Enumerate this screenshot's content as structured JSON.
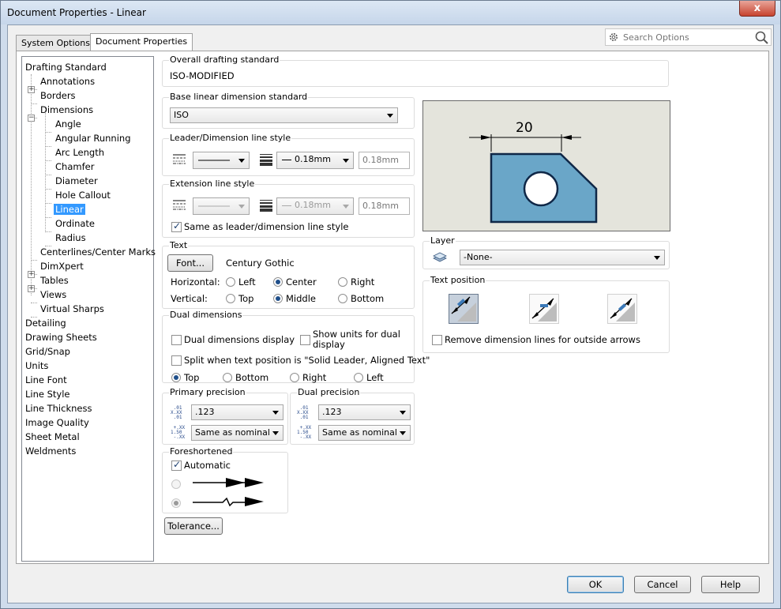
{
  "window": {
    "title": "Document Properties - Linear",
    "close_label": "x"
  },
  "tabs": [
    {
      "label": "System Options",
      "active": false
    },
    {
      "label": "Document Properties",
      "active": true
    }
  ],
  "search": {
    "placeholder": "Search Options"
  },
  "tree": {
    "items": [
      {
        "label": "Drafting Standard"
      },
      {
        "label": "Annotations"
      },
      {
        "label": "Borders"
      },
      {
        "label": "Dimensions"
      },
      {
        "label": "Angle"
      },
      {
        "label": "Angular Running"
      },
      {
        "label": "Arc Length"
      },
      {
        "label": "Chamfer"
      },
      {
        "label": "Diameter"
      },
      {
        "label": "Hole Callout"
      },
      {
        "label": "Linear"
      },
      {
        "label": "Ordinate"
      },
      {
        "label": "Radius"
      },
      {
        "label": "Centerlines/Center Marks"
      },
      {
        "label": "DimXpert"
      },
      {
        "label": "Tables"
      },
      {
        "label": "Views"
      },
      {
        "label": "Virtual Sharps"
      },
      {
        "label": "Detailing"
      },
      {
        "label": "Drawing Sheets"
      },
      {
        "label": "Grid/Snap"
      },
      {
        "label": "Units"
      },
      {
        "label": "Line Font"
      },
      {
        "label": "Line Style"
      },
      {
        "label": "Line Thickness"
      },
      {
        "label": "Image Quality"
      },
      {
        "label": "Sheet Metal"
      },
      {
        "label": "Weldments"
      }
    ]
  },
  "overall": {
    "title": "Overall drafting standard",
    "value": "ISO-MODIFIED"
  },
  "base_standard": {
    "title": "Base linear dimension standard",
    "value": "ISO"
  },
  "leader_style": {
    "title": "Leader/Dimension line style",
    "thickness": "0.18mm",
    "custom": "0.18mm"
  },
  "extension_style": {
    "title": "Extension line style",
    "thickness": "0.18mm",
    "custom": "0.18mm",
    "same_as_label": "Same as leader/dimension line style",
    "same_as_checked": true
  },
  "text": {
    "title": "Text",
    "font_button": "Font...",
    "font_name": "Century Gothic",
    "horizontal_label": "Horizontal:",
    "vertical_label": "Vertical:",
    "h_left": "Left",
    "h_center": "Center",
    "h_right": "Right",
    "v_top": "Top",
    "v_middle": "Middle",
    "v_bottom": "Bottom",
    "horizontal_selected": "Center",
    "vertical_selected": "Middle"
  },
  "dual": {
    "title": "Dual dimensions",
    "display_label": "Dual dimensions display",
    "show_units_label_1": "Show units for dual",
    "show_units_label_2": "display",
    "split_label": "Split when text position is \"Solid Leader, Aligned Text\"",
    "pos_top": "Top",
    "pos_bottom": "Bottom",
    "pos_right": "Right",
    "pos_left": "Left",
    "selected": "Top"
  },
  "primary_precision": {
    "title": "Primary precision",
    "value": ".123",
    "tolerance": "Same as nominal"
  },
  "dual_precision": {
    "title": "Dual precision",
    "value": ".123",
    "tolerance": "Same as nominal"
  },
  "foreshortened": {
    "title": "Foreshortened",
    "automatic_label": "Automatic",
    "automatic_checked": true
  },
  "tolerance_button": "Tolerance...",
  "preview": {
    "dimension_value": "20",
    "part_color": "#6aa6c8",
    "background": "#e4e4dc"
  },
  "layer": {
    "title": "Layer",
    "value": "-None-"
  },
  "text_position": {
    "title": "Text position",
    "remove_label": "Remove dimension lines for outside arrows"
  },
  "buttons": {
    "ok": "OK",
    "cancel": "Cancel",
    "help": "Help"
  },
  "colors": {
    "accent": "#3399ff",
    "window_frame": "#cfdcec"
  }
}
